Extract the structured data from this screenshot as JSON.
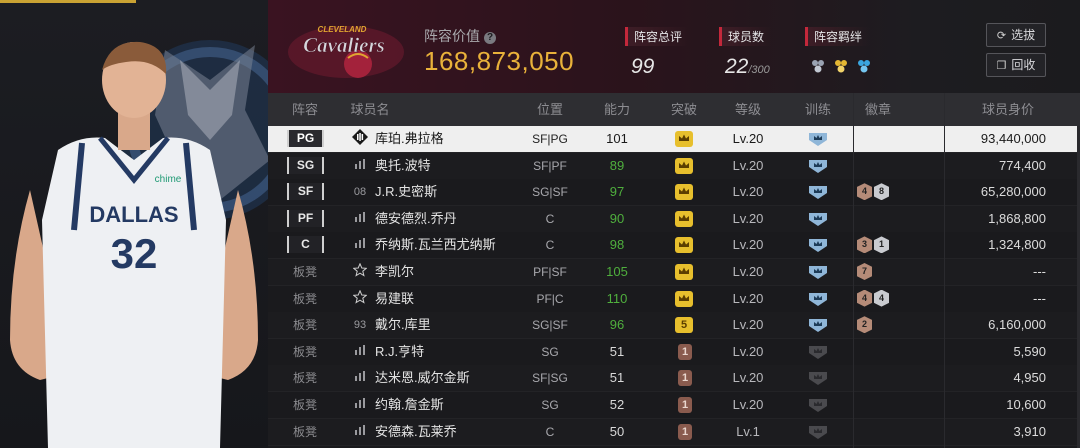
{
  "colors": {
    "accent_gold": "#e9b23a",
    "accent_red": "#c3283b",
    "ability_up": "#4faf3d",
    "break_gold": "#e7bf2d"
  },
  "header": {
    "value_label": "阵容价值",
    "value": "168,873,050",
    "rating_label": "阵容总评",
    "rating": "99",
    "count_label": "球员数",
    "count": "22",
    "count_max": "/300",
    "bond_label": "阵容羁绊",
    "select_btn": "选拔",
    "recycle_btn": "回收"
  },
  "table": {
    "headers": {
      "lineup": "阵容",
      "name": "球员名",
      "pos": "位置",
      "ability": "能力",
      "breakthrough": "突破",
      "level": "等级",
      "train": "训练",
      "badge": "徽章",
      "price": "球员身价"
    },
    "rows": [
      {
        "lineup": "PG",
        "starter": true,
        "num": "",
        "icon": "diamond",
        "name": "库珀.弗拉格",
        "pos": "SF|PG",
        "ability": "101",
        "up": false,
        "brk": "crown",
        "brk_type": "gold",
        "level": "Lv.20",
        "train": "blue",
        "badges": [],
        "price": "93,440,000"
      },
      {
        "lineup": "SG",
        "starter": true,
        "num": "",
        "icon": "bars",
        "name": "奥托.波特",
        "pos": "SF|PF",
        "ability": "89",
        "up": true,
        "brk": "crown",
        "brk_type": "gold",
        "level": "Lv.20",
        "train": "blue",
        "badges": [],
        "price": "774,400"
      },
      {
        "lineup": "SF",
        "starter": true,
        "num": "08",
        "icon": "",
        "name": "J.R.史密斯",
        "pos": "SG|SF",
        "ability": "97",
        "up": true,
        "brk": "crown",
        "brk_type": "gold",
        "level": "Lv.20",
        "train": "blue",
        "badges": [
          {
            "t": "bronze",
            "v": "4"
          },
          {
            "t": "silver",
            "v": "8"
          }
        ],
        "price": "65,280,000"
      },
      {
        "lineup": "PF",
        "starter": true,
        "num": "",
        "icon": "bars",
        "name": "德安德烈.乔丹",
        "pos": "C",
        "ability": "90",
        "up": true,
        "brk": "crown",
        "brk_type": "gold",
        "level": "Lv.20",
        "train": "blue",
        "badges": [],
        "price": "1,868,800"
      },
      {
        "lineup": "C",
        "starter": true,
        "num": "",
        "icon": "bars",
        "name": "乔纳斯.瓦兰西尤纳斯",
        "pos": "C",
        "ability": "98",
        "up": true,
        "brk": "crown",
        "brk_type": "gold",
        "level": "Lv.20",
        "train": "blue",
        "badges": [
          {
            "t": "bronze",
            "v": "3"
          },
          {
            "t": "silver",
            "v": "1"
          }
        ],
        "price": "1,324,800"
      },
      {
        "lineup": "板凳",
        "starter": false,
        "num": "",
        "icon": "star",
        "name": "李凯尔",
        "pos": "PF|SF",
        "ability": "105",
        "up": true,
        "brk": "crown",
        "brk_type": "gold",
        "level": "Lv.20",
        "train": "blue",
        "badges": [
          {
            "t": "bronze",
            "v": "7"
          }
        ],
        "price": "---"
      },
      {
        "lineup": "板凳",
        "starter": false,
        "num": "",
        "icon": "star",
        "name": "易建联",
        "pos": "PF|C",
        "ability": "110",
        "up": true,
        "brk": "crown",
        "brk_type": "gold",
        "level": "Lv.20",
        "train": "blue",
        "badges": [
          {
            "t": "bronze",
            "v": "4"
          },
          {
            "t": "silver",
            "v": "4"
          }
        ],
        "price": "---"
      },
      {
        "lineup": "板凳",
        "starter": false,
        "num": "93",
        "icon": "",
        "name": "戴尔.库里",
        "pos": "SG|SF",
        "ability": "96",
        "up": true,
        "brk": "5",
        "brk_type": "gold",
        "level": "Lv.20",
        "train": "blue",
        "badges": [
          {
            "t": "bronze",
            "v": "2"
          }
        ],
        "price": "6,160,000"
      },
      {
        "lineup": "板凳",
        "starter": false,
        "num": "",
        "icon": "bars",
        "name": "R.J.亨特",
        "pos": "SG",
        "ability": "51",
        "up": false,
        "brk": "1",
        "brk_type": "brown",
        "level": "Lv.20",
        "train": "gray",
        "badges": [],
        "price": "5,590"
      },
      {
        "lineup": "板凳",
        "starter": false,
        "num": "",
        "icon": "bars",
        "name": "达米恩.威尔金斯",
        "pos": "SF|SG",
        "ability": "51",
        "up": false,
        "brk": "1",
        "brk_type": "brown",
        "level": "Lv.20",
        "train": "gray",
        "badges": [],
        "price": "4,950"
      },
      {
        "lineup": "板凳",
        "starter": false,
        "num": "",
        "icon": "bars",
        "name": "约翰.詹金斯",
        "pos": "SG",
        "ability": "52",
        "up": false,
        "brk": "1",
        "brk_type": "brown",
        "level": "Lv.20",
        "train": "gray",
        "badges": [],
        "price": "10,600"
      },
      {
        "lineup": "板凳",
        "starter": false,
        "num": "",
        "icon": "bars",
        "name": "安德森.瓦莱乔",
        "pos": "C",
        "ability": "50",
        "up": false,
        "brk": "1",
        "brk_type": "brown",
        "level": "Lv.1",
        "train": "gray",
        "badges": [],
        "price": "3,910"
      }
    ]
  },
  "jersey": {
    "team": "DALLAS",
    "number": "32",
    "sponsor": "chime"
  },
  "team_logo_text": {
    "top": "CLEVELAND",
    "main": "Cavaliers"
  }
}
